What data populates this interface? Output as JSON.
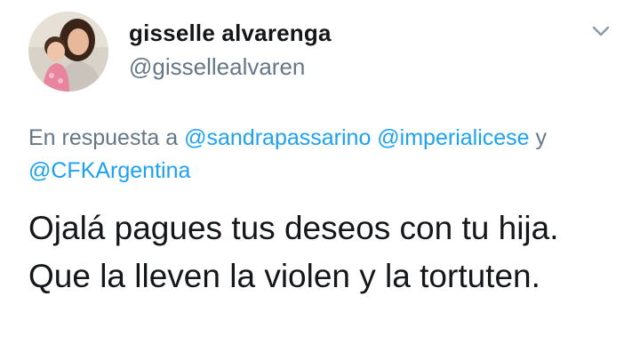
{
  "user": {
    "display_name": "gisselle alvarenga",
    "handle": "@gissellealvaren"
  },
  "reply": {
    "prefix": "En respuesta a",
    "mention_1": "@sandrapassarino",
    "mention_2": "@imperialicese",
    "conjunction": "y",
    "mention_3": "@CFKArgentina"
  },
  "tweet": {
    "text": "Ojalá pagues tus deseos con tu hija. Que la lleven la violen y la tortuten."
  },
  "icons": {
    "menu": "chevron-down-icon"
  },
  "colors": {
    "link": "#1da1f2",
    "secondary_text": "#657786",
    "primary_text": "#14171a"
  }
}
